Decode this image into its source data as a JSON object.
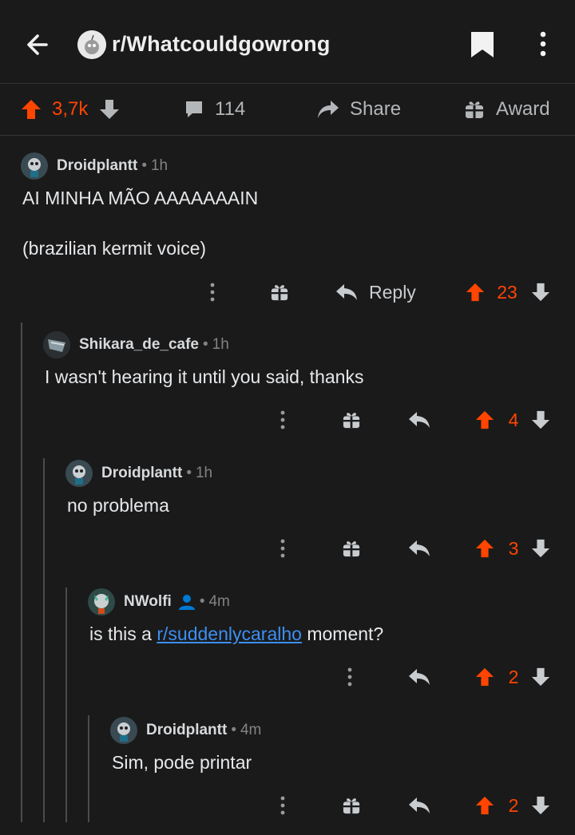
{
  "header": {
    "subreddit": "r/Whatcouldgowrong",
    "icons": {
      "back": "arrow-left-icon",
      "bookmark": "bookmark-icon",
      "more": "more-vertical-icon"
    }
  },
  "post_actions": {
    "score": "3,7k",
    "comments": "114",
    "share_label": "Share",
    "award_label": "Award"
  },
  "colors": {
    "upvote": "#ff4500",
    "background": "#1a1a1b",
    "link": "#3d8ff0"
  },
  "comments": [
    {
      "author": "Droidplantt",
      "separator": "•",
      "time": "1h",
      "lines": [
        "AI MINHA MÃO AAAAAAAIN",
        "(brazilian kermit voice)"
      ],
      "reply_label": "Reply",
      "score": "23"
    },
    {
      "author": "Shikara_de_cafe",
      "separator": "•",
      "time": "1h",
      "lines": [
        "I wasn't hearing it until you said, thanks"
      ],
      "score": "4"
    },
    {
      "author": "Droidplantt",
      "separator": "•",
      "time": "1h",
      "lines": [
        "no problema"
      ],
      "score": "3"
    },
    {
      "author": "NWolfi",
      "separator": "•",
      "time": "4m",
      "body_prefix": "is this a ",
      "body_link": "r/suddenlycaralho",
      "body_suffix": " moment?",
      "score": "2"
    },
    {
      "author": "Droidplantt",
      "separator": "•",
      "time": "4m",
      "lines": [
        "Sim, pode printar"
      ],
      "score": "2"
    }
  ]
}
